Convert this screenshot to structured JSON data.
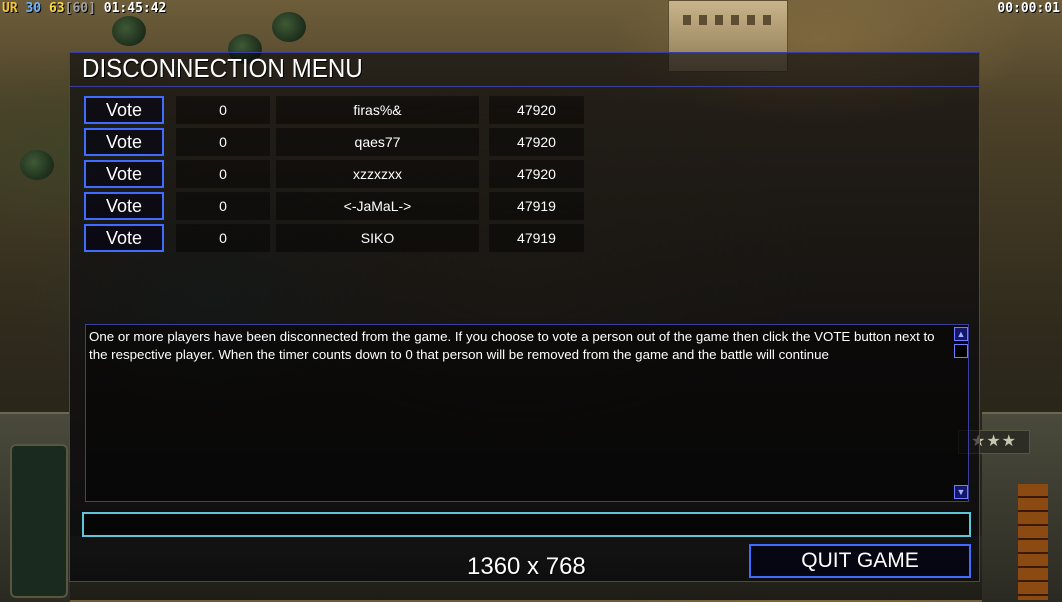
{
  "status_bar": {
    "prefix": "UR",
    "value_a": "30",
    "value_b": "63",
    "value_b_cap": "[60]",
    "clock": "01:45:42",
    "timer": "00:00:01",
    "colors": {
      "prefix": "#f3c43c",
      "value_a": "#6fb4ff",
      "value_b": "#f6d84a",
      "cap": "#a0a0a0",
      "clock": "#ffffff"
    }
  },
  "panel": {
    "title": "DISCONNECTION MENU",
    "vote_label": "Vote",
    "players": [
      {
        "votes": "0",
        "name": "firas%&",
        "ping": "47920"
      },
      {
        "votes": "0",
        "name": "qaes77",
        "ping": "47920"
      },
      {
        "votes": "0",
        "name": "xzzxzxx",
        "ping": "47920"
      },
      {
        "votes": "0",
        "name": "<-JaMaL->",
        "ping": "47919"
      },
      {
        "votes": "0",
        "name": "SIKO",
        "ping": "47919"
      }
    ],
    "message": "One or more players have been disconnected from the game. If you choose to vote a person out of the game then click the VOTE button next to the respective player. When the timer counts down to 0 that person will be removed from the game and the battle will continue",
    "chat_value": "",
    "resolution": "1360 x 768",
    "quit_label": "QUIT GAME",
    "accent_color": "#3f6cff",
    "chat_border_color": "#5fc6d8"
  },
  "hud": {
    "rank_stars": "★★★"
  }
}
